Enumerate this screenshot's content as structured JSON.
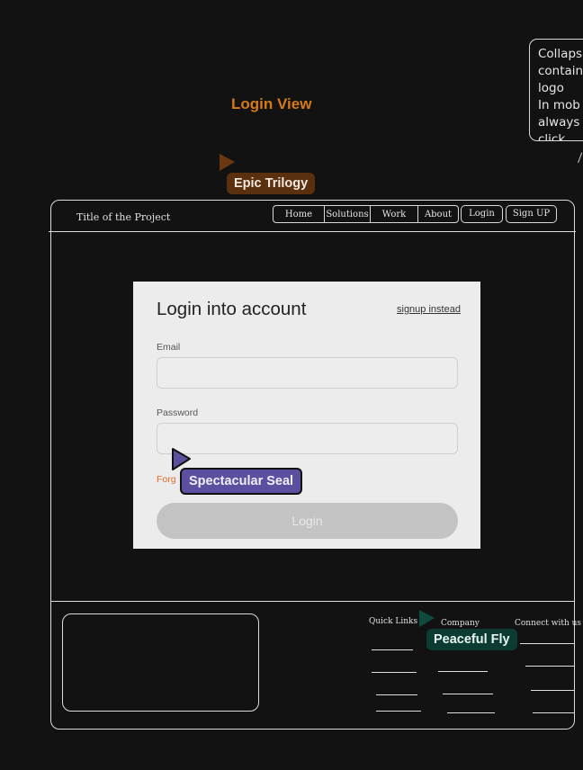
{
  "note": {
    "lines": [
      "Collapse",
      "contain",
      "logo",
      "In mob",
      "always",
      "click"
    ]
  },
  "view_title": "Login View",
  "collaborators": [
    {
      "name": "Epic Trilogy",
      "color": "#5a300f",
      "cursor_color": "#6a3912"
    },
    {
      "name": "Spectacular Seal",
      "color": "#5b4fa0",
      "cursor_color": "#5b4fa0"
    },
    {
      "name": "Peaceful Fly",
      "color": "#0c3b33",
      "cursor_color": "#0f4a3f"
    }
  ],
  "frame": {
    "project_title": "Title of the Project",
    "nav": [
      "Home",
      "Solutions",
      "Work",
      "About"
    ],
    "login_label": "Login",
    "signup_label": "Sign UP"
  },
  "login_card": {
    "title": "Login into  account",
    "signup_link": "signup instead",
    "email_label": "Email",
    "email_value": "",
    "password_label": "Password",
    "password_value": "",
    "forgot_visible": "Forg",
    "submit_label": "Login"
  },
  "footer": {
    "quick_links": "Quick Links",
    "company": "Company",
    "connect": "Connect with us"
  }
}
